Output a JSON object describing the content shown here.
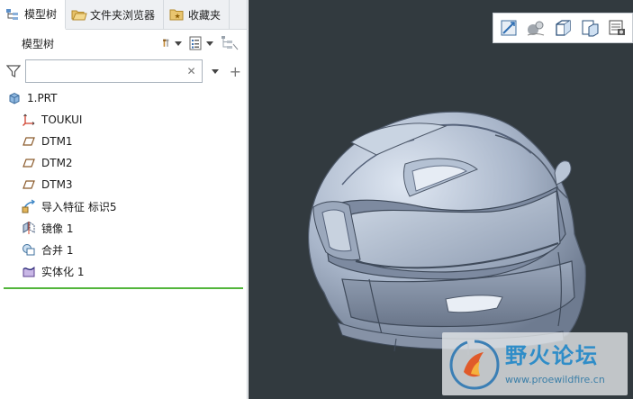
{
  "tabs": [
    {
      "label": "模型树",
      "icon": "model-tree-icon"
    },
    {
      "label": "文件夹浏览器",
      "icon": "folder-browser-icon"
    },
    {
      "label": "收藏夹",
      "icon": "favorites-icon"
    }
  ],
  "panel": {
    "title": "模型树",
    "search_value": ""
  },
  "tree": [
    {
      "label": "1.PRT",
      "icon": "part-icon"
    },
    {
      "label": "TOUKUI",
      "icon": "coordinate-system-icon"
    },
    {
      "label": "DTM1",
      "icon": "datum-plane-icon"
    },
    {
      "label": "DTM2",
      "icon": "datum-plane-icon"
    },
    {
      "label": "DTM3",
      "icon": "datum-plane-icon"
    },
    {
      "label": "导入特征 标识5",
      "icon": "import-feature-icon"
    },
    {
      "label": "镜像 1",
      "icon": "mirror-icon"
    },
    {
      "label": "合并 1",
      "icon": "merge-icon"
    },
    {
      "label": "实体化 1",
      "icon": "solidify-icon"
    }
  ],
  "watermark": {
    "title": "野火论坛",
    "url": "www.proewildfire.cn"
  },
  "colors": {
    "viewport_bg": "#323a3f",
    "model": "#a7b4c7",
    "insert_line": "#52b53b",
    "watermark_text": "#2f8dc8"
  }
}
